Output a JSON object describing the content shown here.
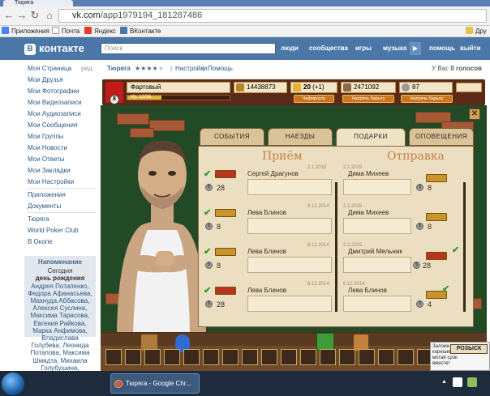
{
  "browser": {
    "tab_title": "Тюряга",
    "url_host": "vk.com",
    "url_path": "/app1979194_181287486",
    "bookmarks": [
      {
        "label": "Приложения",
        "color": "#4285f4"
      },
      {
        "label": "Почта",
        "color": "#cccccc"
      },
      {
        "label": "Яндекс",
        "color": "#e33b2e"
      },
      {
        "label": "ВКонтакте",
        "color": "#4a76a8"
      },
      {
        "label": "Дру",
        "color": "#e8c04a"
      }
    ]
  },
  "vk": {
    "logo": "контакте",
    "logo_mark": "В",
    "search_placeholder": "Поиск",
    "top_nav": [
      "люди",
      "сообщества",
      "игры",
      "музыка",
      "помощь",
      "выйти"
    ],
    "left_menu": [
      "Моя Страница",
      "Мои Друзья",
      "Мои Фотографии",
      "Мои Видеозаписи",
      "Мои Аудиозаписи",
      "Мои Сообщения",
      "Мои Группы",
      "Мои Новости",
      "Мои Ответы",
      "Мои Закладки",
      "Мои Настройки"
    ],
    "left_menu_edit": "ред.",
    "left_menu_2": [
      "Приложения",
      "Документы"
    ],
    "left_menu_3": [
      "Тюряга",
      "World Poker Club",
      "В Окопе"
    ],
    "reminder": {
      "title": "Напоминание",
      "lines": [
        "Сегодня",
        "день рождения",
        "Андрея Потапенко, Федора Афанасьева, Махнуда Аббасова, Алексея Суслина, Максима Тарасова, Евгения Райкова, Марка Анфимова, Владислава Голубева, Леонида Потапова, Максима Шмидта, Михаила Голубушина, Александра"
      ]
    }
  },
  "app": {
    "name": "Тюряга",
    "rating_stars": "★★★★",
    "rating_stars_dim": "★",
    "links": [
      "Настройки",
      "Помощь"
    ],
    "votes_prefix": "У Вас",
    "votes_value": "0 голосов"
  },
  "hud": {
    "level": "8",
    "player_name": "Фартовый",
    "xp_text": "Ур. 12/36",
    "xp_fraction": 0.33,
    "money": "14438873",
    "energy": "20",
    "energy_timer": "(+1) 1:03",
    "power": "2471092",
    "coins": "87",
    "buttons": [
      "Чифирнуть",
      "Напрячь барыгу",
      "Напрячь барыгу"
    ]
  },
  "panel": {
    "tabs": [
      "СОБЫТИЯ",
      "НАЕЗДЫ",
      "ПОДАРКИ",
      "ОПОВЕЩЕНИЯ"
    ],
    "active_tab": 2,
    "col_received": "Приём",
    "col_sent": "Отправка",
    "received": [
      {
        "name": "Сергей Драгунов",
        "date": "2.1.2015",
        "count": "28",
        "crown": "red"
      },
      {
        "name": "Лева Блинов",
        "date": "9.12.2014",
        "count": "8",
        "crown": "gold"
      },
      {
        "name": "Лева Блинов",
        "date": "8.12.2014",
        "count": "8",
        "crown": "gold"
      },
      {
        "name": "Лева Блинов",
        "date": "8.12.2014",
        "count": "28",
        "crown": "red"
      }
    ],
    "sent": [
      {
        "name": "Дима Михеев",
        "date": "2.1.2015",
        "count": "8",
        "crown": "gold"
      },
      {
        "name": "Дима Михеев",
        "date": "2.1.2015",
        "count": "8",
        "crown": "gold"
      },
      {
        "name": "Дмитрий Мельник",
        "date": "2.1.2015",
        "count": "28",
        "crown": "red"
      },
      {
        "name": "Лева Блинов",
        "date": "8.12.2014",
        "count": "4",
        "crown": "gold"
      }
    ]
  },
  "ad": {
    "lines": [
      "Заложи",
      "корешей и",
      "мотай срок",
      "вместе!"
    ],
    "badge": "РОЗЫСК"
  },
  "taskbar": {
    "item": "Тюряга - Google Chr..."
  }
}
